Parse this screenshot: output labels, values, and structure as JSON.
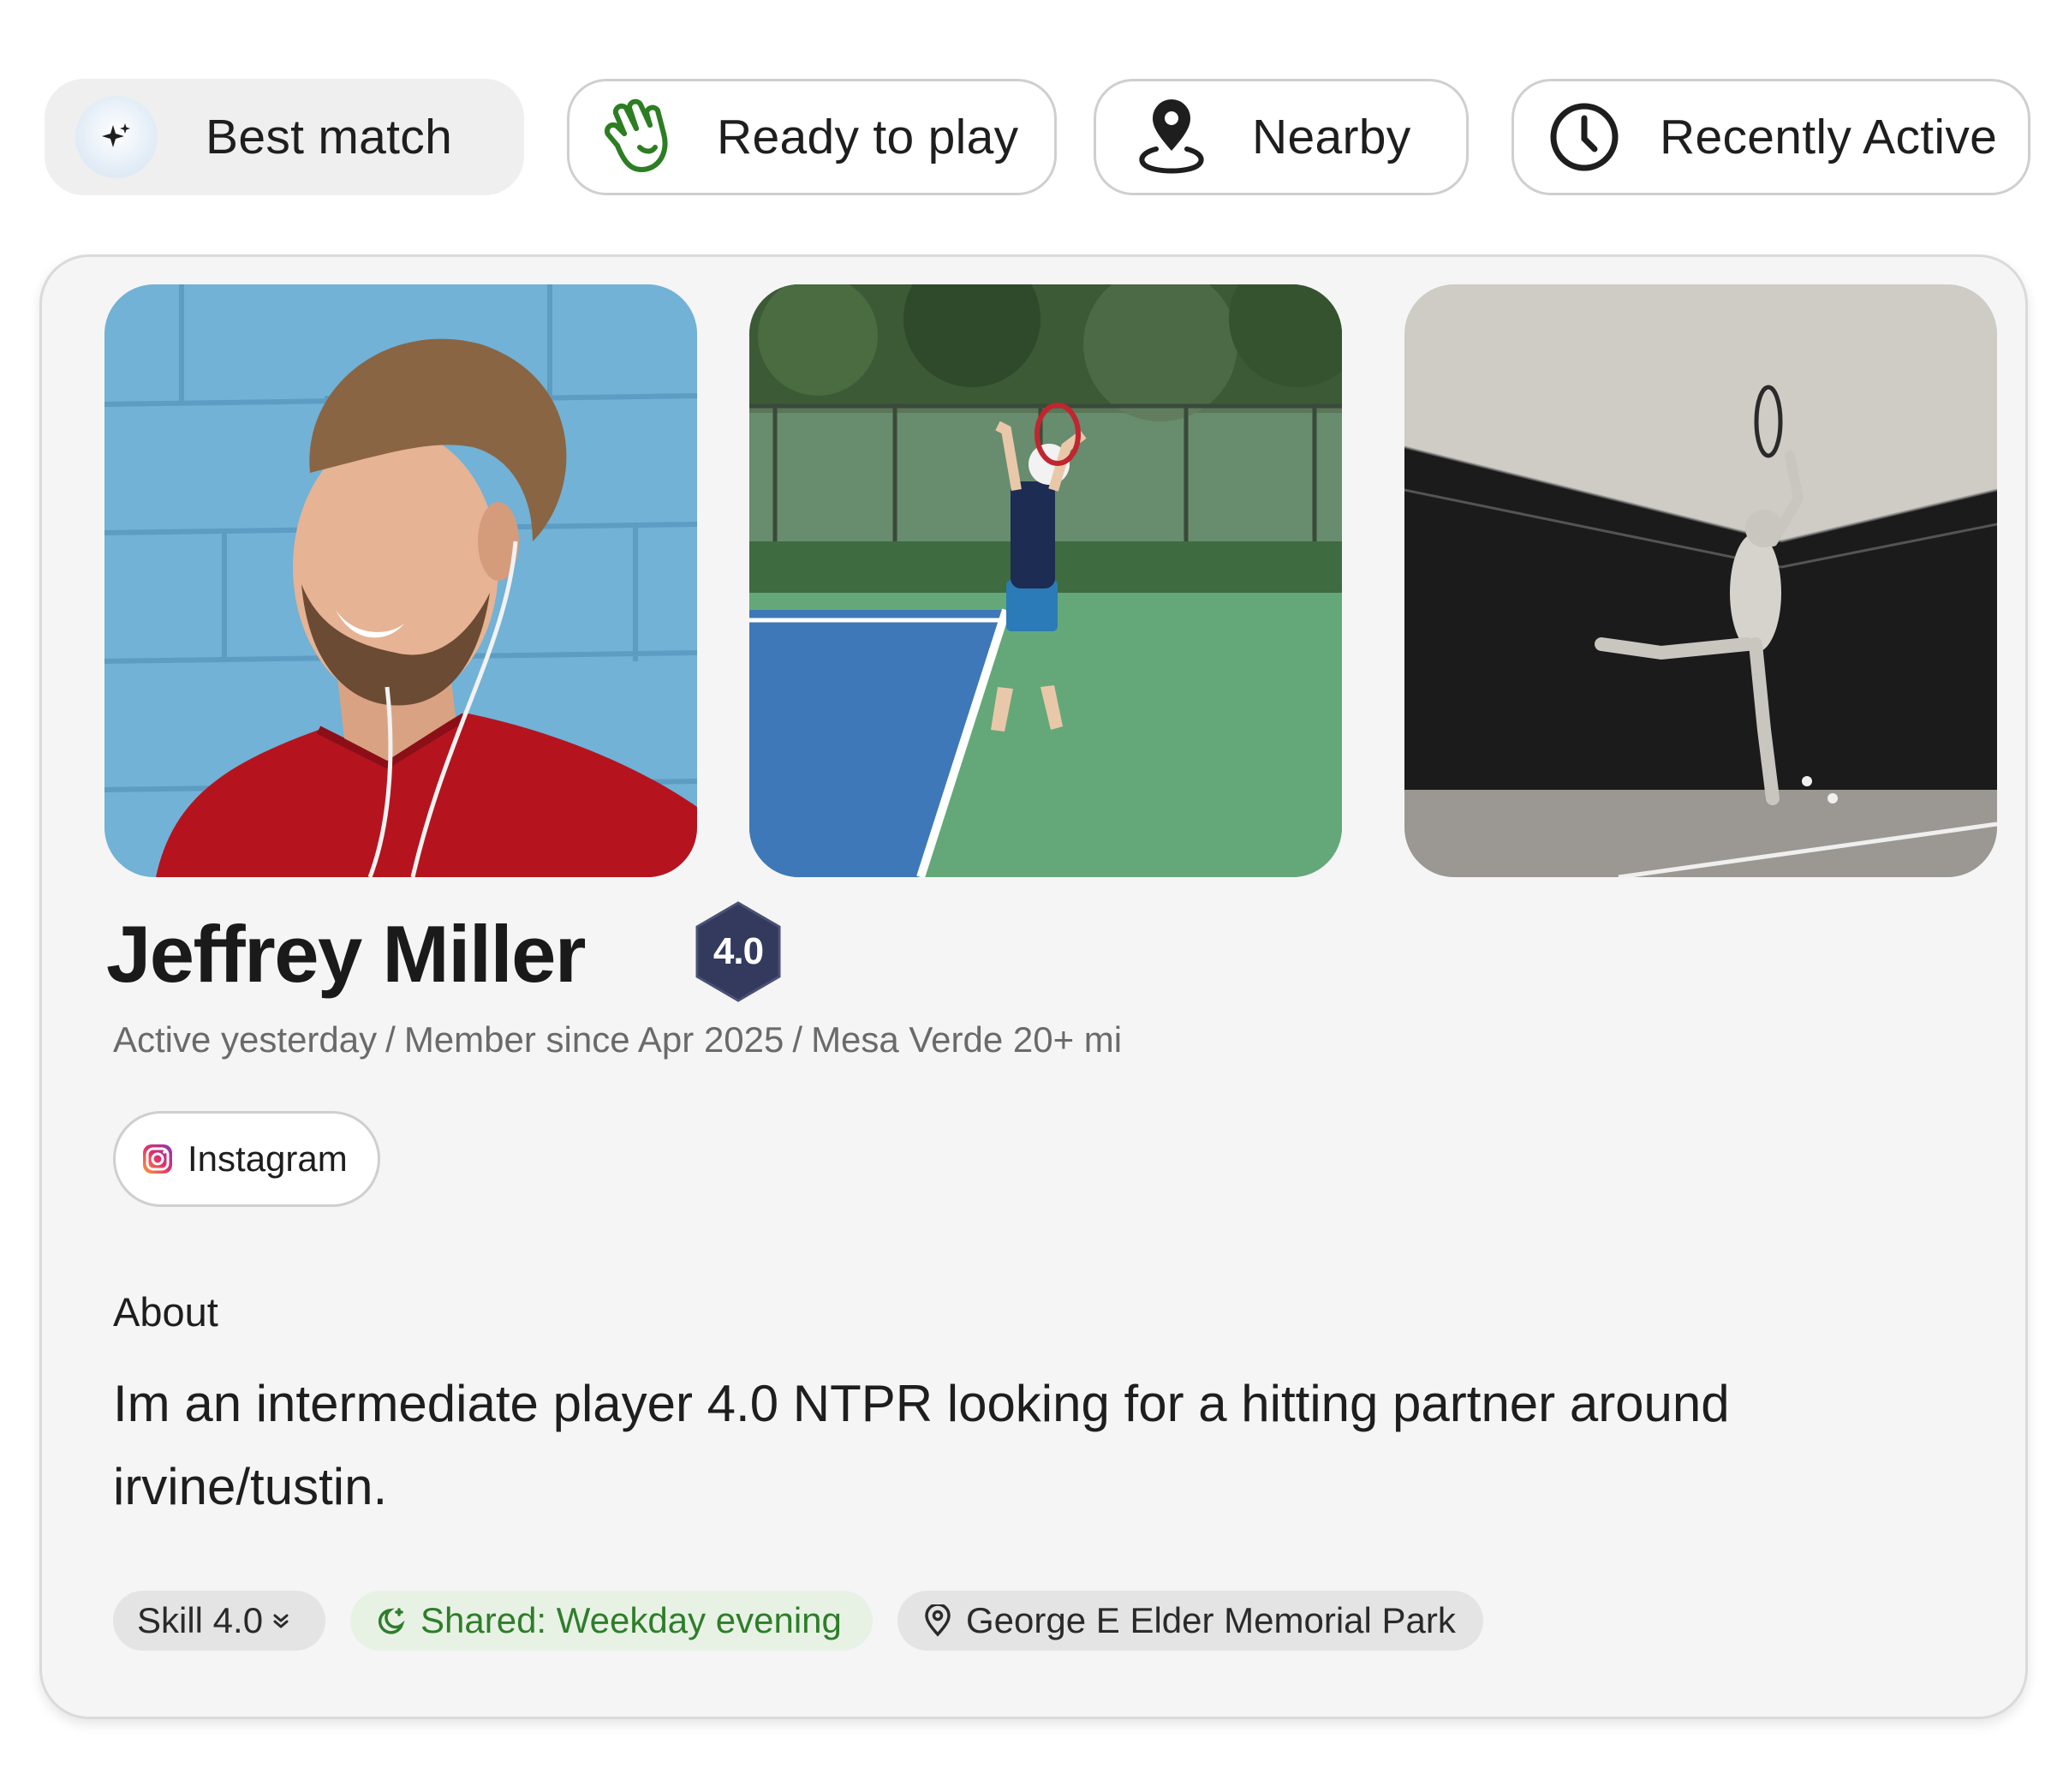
{
  "filters": {
    "best_match": "Best match",
    "ready_to_play": "Ready to play",
    "nearby": "Nearby",
    "recently_active": "Recently Active",
    "icons": [
      "sparkle-icon",
      "waving-hand-icon",
      "location-pin-icon",
      "clock-icon"
    ],
    "ready_icon_color": "#2d7d23"
  },
  "profile": {
    "name": "Jeffrey Miller",
    "rating": "4.0",
    "rating_color": "#333a5e",
    "photos": [
      "portrait-photo",
      "tennis-serve-photo",
      "tennis-bw-photo"
    ],
    "meta": {
      "active": "Active yesterday",
      "separator": "/",
      "member_since": "Member since Apr 2025",
      "location": "Mesa Verde 20+ mi"
    },
    "instagram_label": "Instagram",
    "about_heading": "About",
    "about_text": "Im an intermediate player 4.0 NTPR looking for a hitting partner around irvine/tustin.",
    "tags": {
      "skill": "Skill 4.0",
      "shared": "Shared: Weekday evening",
      "park": "George E Elder Memorial Park"
    },
    "accent_green": "#2f7d2a"
  }
}
